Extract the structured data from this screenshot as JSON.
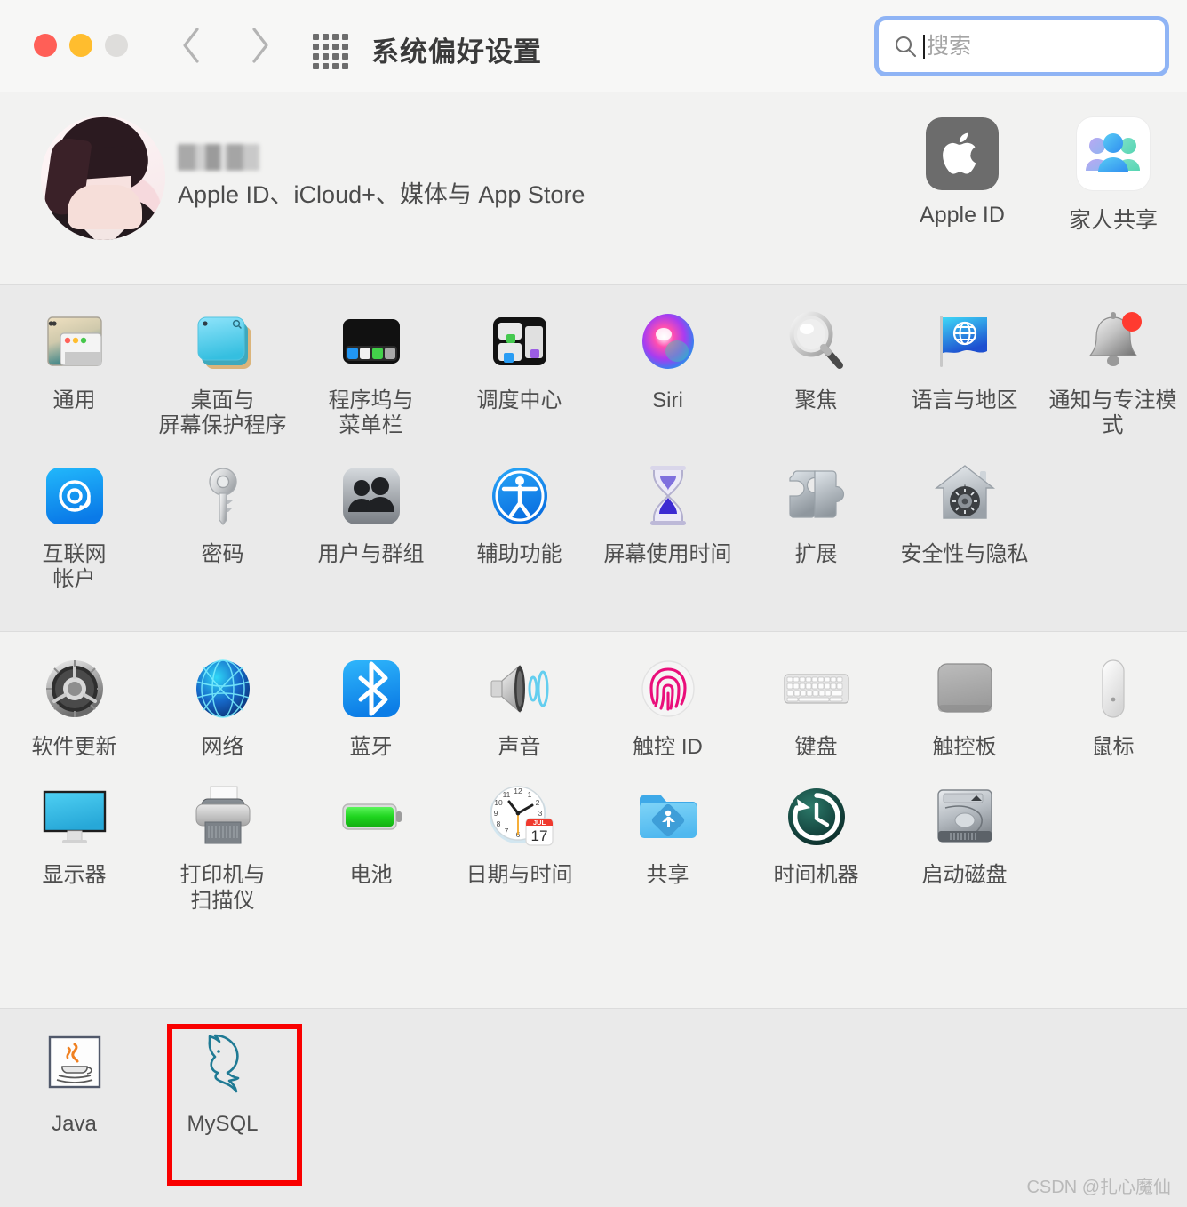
{
  "window": {
    "title": "系统偏好设置",
    "traffic_lights": [
      "close",
      "minimize",
      "zoom"
    ],
    "back_label": "后退",
    "forward_label": "前进",
    "grid_label": "显示全部"
  },
  "search": {
    "placeholder": "搜索",
    "value": "",
    "focused": true,
    "focus_ring_color": "#8fb4f5"
  },
  "account": {
    "name_redacted": "",
    "subtitle": "Apple ID、iCloud+、媒体与 App Store",
    "shortcuts": [
      {
        "label": "Apple ID",
        "icon": "apple-logo-icon"
      },
      {
        "label": "家人共享",
        "icon": "family-sharing-icon"
      }
    ]
  },
  "sections": [
    {
      "id": "system-section",
      "rows": [
        [
          {
            "label": "通用",
            "icon": "general-icon"
          },
          {
            "label": "桌面与\n屏幕保护程序",
            "icon": "desktop-screensaver-icon"
          },
          {
            "label": "程序坞与\n菜单栏",
            "icon": "dock-menubar-icon"
          },
          {
            "label": "调度中心",
            "icon": "mission-control-icon"
          },
          {
            "label": "Siri",
            "icon": "siri-icon"
          },
          {
            "label": "聚焦",
            "icon": "spotlight-icon"
          },
          {
            "label": "语言与地区",
            "icon": "language-region-icon"
          },
          {
            "label": "通知与专注模式",
            "icon": "notifications-focus-icon"
          }
        ],
        [
          {
            "label": "互联网\n帐户",
            "icon": "internet-accounts-icon"
          },
          {
            "label": "密码",
            "icon": "passwords-key-icon"
          },
          {
            "label": "用户与群组",
            "icon": "users-groups-icon"
          },
          {
            "label": "辅助功能",
            "icon": "accessibility-icon"
          },
          {
            "label": "屏幕使用时间",
            "icon": "screen-time-icon"
          },
          {
            "label": "扩展",
            "icon": "extensions-puzzle-icon"
          },
          {
            "label": "安全性与隐私",
            "icon": "security-privacy-icon"
          }
        ]
      ]
    },
    {
      "id": "hardware-section",
      "rows": [
        [
          {
            "label": "软件更新",
            "icon": "software-update-icon"
          },
          {
            "label": "网络",
            "icon": "network-globe-icon"
          },
          {
            "label": "蓝牙",
            "icon": "bluetooth-icon"
          },
          {
            "label": "声音",
            "icon": "sound-speaker-icon"
          },
          {
            "label": "触控 ID",
            "icon": "touch-id-icon"
          },
          {
            "label": "键盘",
            "icon": "keyboard-icon"
          },
          {
            "label": "触控板",
            "icon": "trackpad-icon"
          },
          {
            "label": "鼠标",
            "icon": "mouse-icon"
          }
        ],
        [
          {
            "label": "显示器",
            "icon": "displays-icon"
          },
          {
            "label": "打印机与\n扫描仪",
            "icon": "printers-scanners-icon"
          },
          {
            "label": "电池",
            "icon": "battery-icon"
          },
          {
            "label": "日期与时间",
            "icon": "date-time-icon",
            "badge_month": "JUL",
            "badge_day": "17"
          },
          {
            "label": "共享",
            "icon": "sharing-folder-icon"
          },
          {
            "label": "时间机器",
            "icon": "time-machine-icon"
          },
          {
            "label": "启动磁盘",
            "icon": "startup-disk-icon"
          }
        ]
      ]
    },
    {
      "id": "third-party-section",
      "rows": [
        [
          {
            "label": "Java",
            "icon": "java-icon"
          },
          {
            "label": "MySQL",
            "icon": "mysql-dolphin-icon",
            "highlighted": true
          }
        ]
      ]
    }
  ],
  "annotation": {
    "highlight_color": "#f90000",
    "target_label": "MySQL"
  },
  "watermark": "CSDN @扎心魔仙"
}
